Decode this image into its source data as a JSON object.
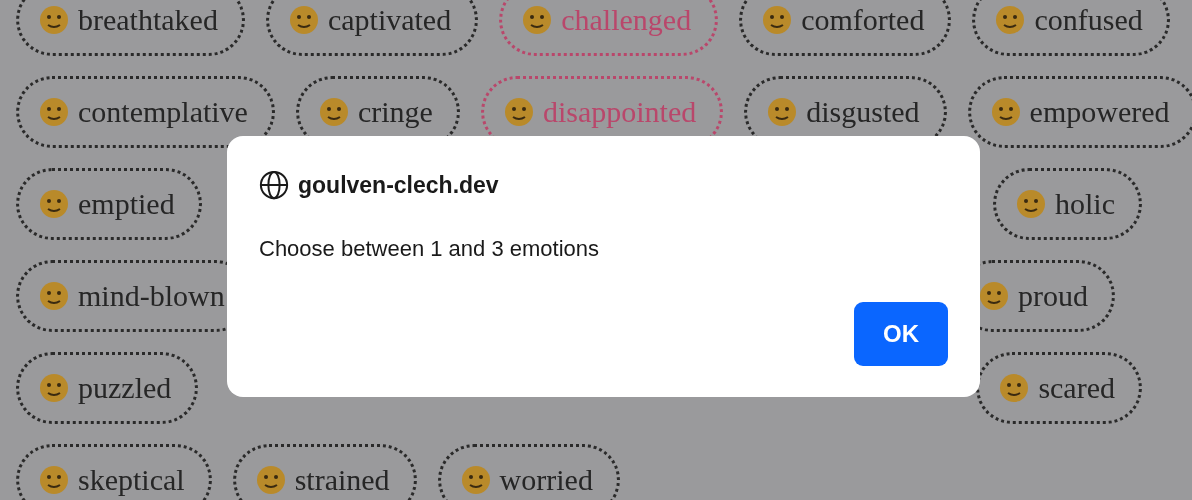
{
  "chips": [
    {
      "start": [
        {
          "label": "breathtaked",
          "selected": false
        },
        {
          "label": "captivated",
          "selected": false
        },
        {
          "label": "challenged",
          "selected": true
        },
        {
          "label": "comforted",
          "selected": false
        },
        {
          "label": "confused",
          "selected": false
        }
      ]
    },
    {
      "start": [
        {
          "label": "contemplative",
          "selected": false
        },
        {
          "label": "cringe",
          "selected": false
        },
        {
          "label": "disappointed",
          "selected": true
        },
        {
          "label": "disgusted",
          "selected": false
        },
        {
          "label": "empowered",
          "selected": false
        }
      ]
    },
    {
      "start": [
        {
          "label": "emptied",
          "selected": false
        }
      ],
      "end": [
        {
          "label": "holic",
          "selected": false
        }
      ]
    },
    {
      "start": [
        {
          "label": "mind-blown",
          "selected": false
        }
      ],
      "end": [
        {
          "label": "proud",
          "selected": false
        }
      ]
    },
    {
      "start": [
        {
          "label": "puzzled",
          "selected": false
        }
      ],
      "end": [
        {
          "label": "scared",
          "selected": false
        }
      ]
    },
    {
      "start": [
        {
          "label": "skeptical",
          "selected": false
        },
        {
          "label": "strained",
          "selected": false
        },
        {
          "label": "worried",
          "selected": false
        }
      ]
    }
  ],
  "dialog": {
    "site": "goulven-clech.dev",
    "message": "Choose between 1 and 3 emotions",
    "button": "OK"
  }
}
